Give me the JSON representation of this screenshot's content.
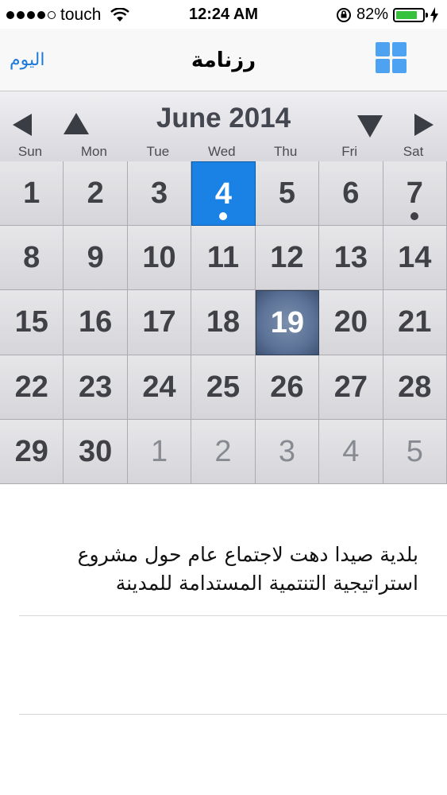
{
  "status_bar": {
    "carrier": "touch",
    "time": "12:24 AM",
    "battery": "82%",
    "battery_level": 0.82,
    "icons": [
      "signal-dots-icon",
      "wifi-icon",
      "rotation-lock-icon",
      "battery-icon",
      "charging-bolt-icon"
    ]
  },
  "navbar": {
    "today_button": "اليوم",
    "title": "رزنامة",
    "view_toggle_icon": "grid-icon"
  },
  "calendar": {
    "month_label": "June 2014",
    "controls": [
      "prev-month-icon",
      "prev-year-icon",
      "next-year-icon",
      "next-month-icon"
    ],
    "weekdays": [
      "Sun",
      "Mon",
      "Tue",
      "Wed",
      "Thu",
      "Fri",
      "Sat"
    ],
    "weeks": [
      [
        "1",
        "2",
        "3",
        "4",
        "5",
        "6",
        "7"
      ],
      [
        "8",
        "9",
        "10",
        "11",
        "12",
        "13",
        "14"
      ],
      [
        "15",
        "16",
        "17",
        "18",
        "19",
        "20",
        "21"
      ],
      [
        "22",
        "23",
        "24",
        "25",
        "26",
        "27",
        "28"
      ],
      [
        "29",
        "30",
        "1",
        "2",
        "3",
        "4",
        "5"
      ]
    ],
    "selected_day": "4",
    "highlighted_day": "19",
    "event_days": [
      "4",
      "7"
    ],
    "colors": {
      "selected": "#1a82e4",
      "highlight": "#5c7398",
      "accent": "#1e7bd8"
    }
  },
  "events": [
    {
      "text": "بلدية صيدا دهت لاجتماع عام حول مشروع استراتيجية التنتمية المستدامة للمدينة"
    }
  ]
}
